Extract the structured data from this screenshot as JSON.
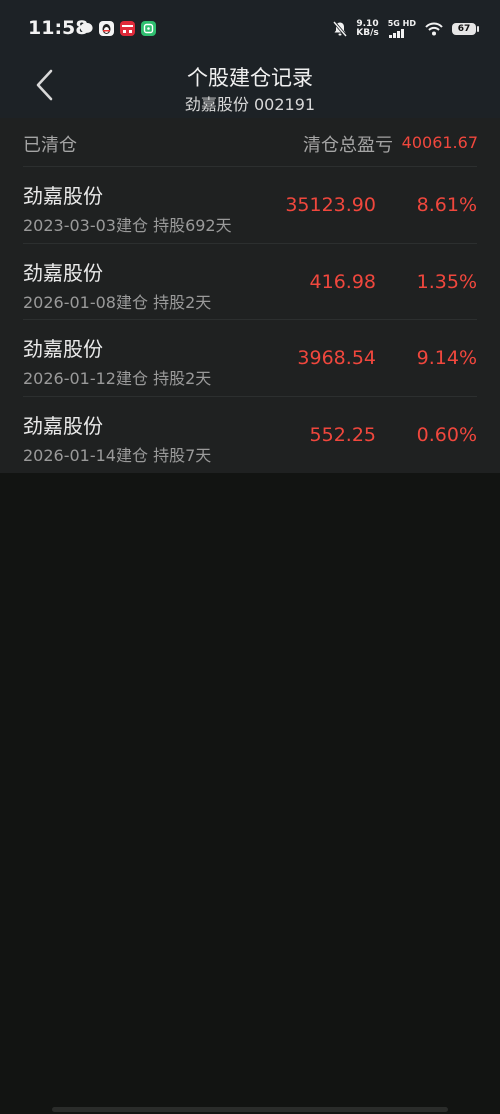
{
  "status_bar": {
    "time": "11:58",
    "speed_value": "9.10",
    "speed_unit": "KB/s",
    "network": "5G HD",
    "battery": "67"
  },
  "header": {
    "title": "个股建仓记录",
    "subtitle": "劲嘉股份 002191"
  },
  "summary": {
    "label": "已清仓",
    "total_label": "清仓总盈亏",
    "total_value": "40061.67"
  },
  "records": [
    {
      "name": "劲嘉股份",
      "meta": "2023-03-03建仓 持股692天",
      "profit": "35123.90",
      "percent": "8.61%"
    },
    {
      "name": "劲嘉股份",
      "meta": "2026-01-08建仓 持股2天",
      "profit": "416.98",
      "percent": "1.35%"
    },
    {
      "name": "劲嘉股份",
      "meta": "2026-01-12建仓 持股2天",
      "profit": "3968.54",
      "percent": "9.14%"
    },
    {
      "name": "劲嘉股份",
      "meta": "2026-01-14建仓 持股7天",
      "profit": "552.25",
      "percent": "0.60%"
    }
  ],
  "colors": {
    "gain": "#f0473d",
    "background": "#121412",
    "card": "#1f2121",
    "header": "#1d2226"
  },
  "icons": [
    "chat-bubble-icon",
    "qq-penguin-icon",
    "app-badge-icon",
    "wechat-like-icon",
    "mute-bell-icon",
    "signal-icon",
    "wifi-icon",
    "battery-icon",
    "back-chevron-icon"
  ]
}
